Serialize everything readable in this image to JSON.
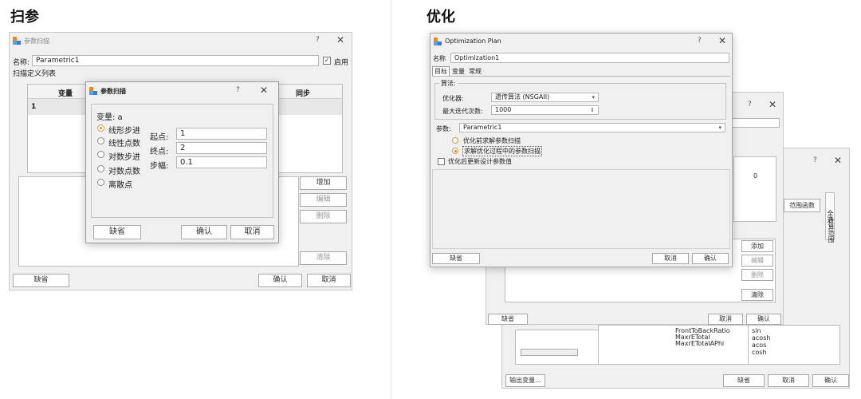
{
  "left": {
    "heading": "扫参",
    "window": {
      "title": "参数扫描",
      "help": "?",
      "close": "✕",
      "name_label": "名称:",
      "name_value": "Parametric1",
      "enable_check": "✓",
      "enable_label": "启用",
      "list_label": "扫描定义列表",
      "col_var": "变量",
      "col_sync": "同步",
      "row_index": "1",
      "btn_add": "增加",
      "btn_edit": "编辑",
      "btn_delete": "删除",
      "btn_clear": "清除",
      "btn_default": "缺省",
      "btn_ok": "确认",
      "btn_cancel": "取消"
    },
    "dialog": {
      "title": "参数扫描",
      "help": "?",
      "close": "✕",
      "variable_label": "变量: a",
      "options": [
        "线形步进",
        "线性点数",
        "对数步进",
        "对数点数",
        "离散点"
      ],
      "start_label": "起点:",
      "start_value": "1",
      "end_label": "终点:",
      "end_value": "2",
      "step_label": "步幅:",
      "step_value": "0.1",
      "btn_default": "缺省",
      "btn_ok": "确认",
      "btn_cancel": "取消"
    }
  },
  "right": {
    "heading": "优化",
    "plan": {
      "title": "Optimization Plan",
      "help": "?",
      "close": "✕",
      "name_label": "名称",
      "name_value": "Optimization1",
      "tabs": [
        "目标",
        "变量",
        "常规"
      ],
      "algo_group": "算法:",
      "optimizer_label": "优化器:",
      "optimizer_value": "遗传算法 (NSGAII)",
      "max_iter_label": "最大迭代次数:",
      "max_iter_value": "1000",
      "param_label": "参数:",
      "param_value": "Parametric1",
      "opt_before": "优化前求解参数扫描",
      "opt_during": "求解优化过程中的参数扫描",
      "update_after": "优化后更新设计参数值",
      "btn_default": "缺省",
      "btn_cancel": "取消",
      "btn_ok": "确认"
    },
    "back1": {
      "help": "?",
      "close": "✕",
      "col_val": "0",
      "btn_add": "添加",
      "btn_edit": "编辑",
      "btn_delete": "删除",
      "btn_clear": "清除",
      "btn_default": "缺省",
      "btn_cancel": "取消",
      "btn_ok": "确认"
    },
    "back2": {
      "help": "?",
      "close": "✕",
      "range_fn": "范围函数",
      "side_tab1": "全选",
      "side_tab2": "计算范围",
      "list_items": [
        "FrontToBackRatio",
        "MaxrETotal",
        "MaxrETotalAPhi"
      ],
      "fn_items": [
        "sin",
        "acosh",
        "acos",
        "cosh"
      ],
      "btn_output": "输出变量...",
      "btn_default": "缺省",
      "btn_cancel": "取消",
      "btn_ok": "确认"
    }
  }
}
